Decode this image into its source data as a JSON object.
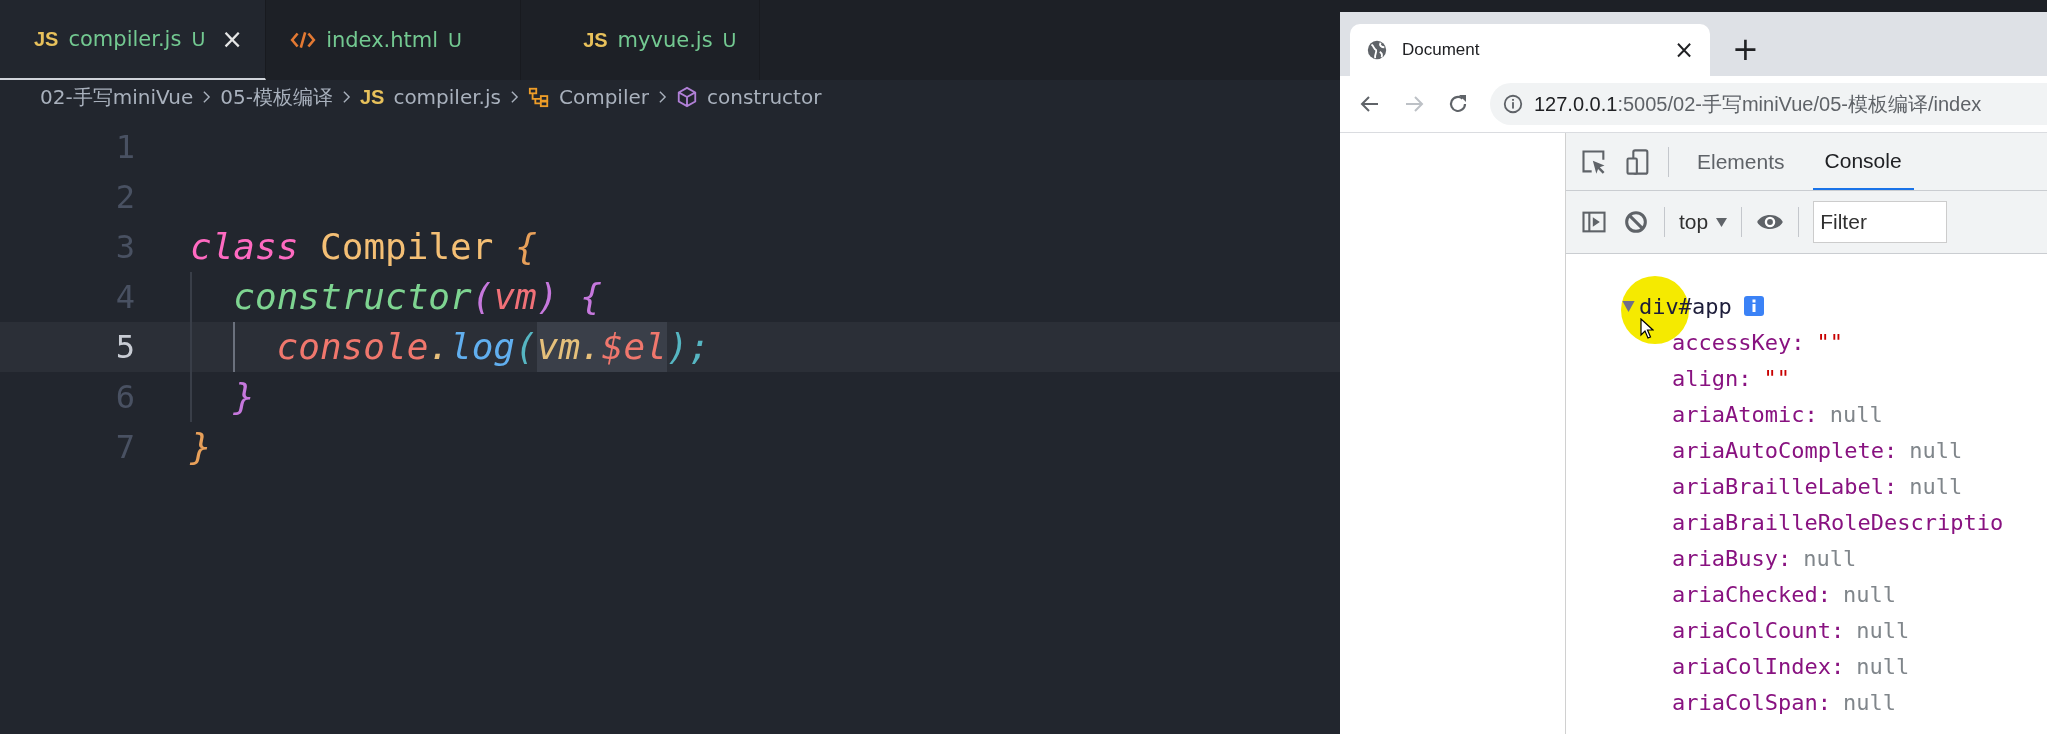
{
  "editor": {
    "tabs": [
      {
        "kind": "js",
        "badge": "JS",
        "label": "compiler.js",
        "status": "U",
        "close": "×",
        "selected": true
      },
      {
        "kind": "html",
        "label": "index.html",
        "status": "U",
        "selected": false
      },
      {
        "kind": "js",
        "badge": "JS",
        "label": "myvue.js",
        "status": "U",
        "selected": false
      }
    ],
    "breadcrumb": [
      {
        "kind": "folder",
        "label": "02-手写miniVue"
      },
      {
        "kind": "folder",
        "label": "05-模板编译"
      },
      {
        "kind": "js",
        "badge": "JS",
        "label": "compiler.js"
      },
      {
        "kind": "class",
        "label": "Compiler"
      },
      {
        "kind": "method",
        "label": "constructor"
      }
    ],
    "lines": [
      {
        "number": "1",
        "current": false
      },
      {
        "number": "2",
        "current": false
      },
      {
        "number": "3",
        "current": false,
        "tokens": [
          {
            "text": "class",
            "kind": "keyword",
            "selected": false
          },
          {
            "text": " Compiler",
            "kind": "class",
            "selected": false
          },
          {
            "text": " {",
            "kind": "brace",
            "selected": false
          }
        ]
      },
      {
        "number": "4",
        "current": false,
        "tokens": [
          {
            "text": "  constructor",
            "kind": "function",
            "selected": false
          },
          {
            "text": "(",
            "kind": "paren",
            "selected": false
          },
          {
            "text": "vm",
            "kind": "param",
            "selected": false
          },
          {
            "text": ")",
            "kind": "paren",
            "selected": false
          },
          {
            "text": " {",
            "kind": "paren",
            "selected": false
          }
        ]
      },
      {
        "number": "5",
        "current": true,
        "tokens": [
          {
            "text": "    console",
            "kind": "variable",
            "selected": false
          },
          {
            "text": ".",
            "kind": "punct",
            "selected": false
          },
          {
            "text": "log",
            "kind": "method",
            "selected": false
          },
          {
            "text": "(",
            "kind": "call",
            "selected": false
          },
          {
            "text": "vm",
            "kind": "object",
            "selected": true
          },
          {
            "text": ".",
            "kind": "punct",
            "selected": true
          },
          {
            "text": "$el",
            "kind": "variable",
            "selected": true
          },
          {
            "text": ");",
            "kind": "call",
            "selected": false
          }
        ]
      },
      {
        "number": "6",
        "current": false,
        "tokens": [
          {
            "text": "  }",
            "kind": "paren",
            "selected": false
          }
        ]
      },
      {
        "number": "7",
        "current": false,
        "tokens": [
          {
            "text": "}",
            "kind": "brace",
            "selected": false
          }
        ]
      }
    ]
  },
  "browser": {
    "tab": {
      "title": "Document",
      "close": "×"
    },
    "new_tab": "+",
    "address": {
      "host": "127.0.0.1",
      "path": ":5005/02-手写miniVue/05-模板编译/index"
    },
    "devtools": {
      "tabs": [
        {
          "label": "Elements",
          "selected": false
        },
        {
          "label": "Console",
          "selected": true
        }
      ],
      "context": "top",
      "filter": {
        "placeholder": "Filter"
      },
      "console": {
        "object": "div#app",
        "expanded": true,
        "properties": [
          {
            "name": "accessKey:",
            "value": "\"\"",
            "kind": "string"
          },
          {
            "name": "align:",
            "value": "\"\"",
            "kind": "string"
          },
          {
            "name": "ariaAtomic:",
            "value": "null",
            "kind": "null"
          },
          {
            "name": "ariaAutoComplete:",
            "value": "null",
            "kind": "null"
          },
          {
            "name": "ariaBrailleLabel:",
            "value": "null",
            "kind": "null"
          },
          {
            "name": "ariaBrailleRoleDescriptio"
          },
          {
            "name": "ariaBusy:",
            "value": "null",
            "kind": "null"
          },
          {
            "name": "ariaChecked:",
            "value": "null",
            "kind": "null"
          },
          {
            "name": "ariaColCount:",
            "value": "null",
            "kind": "null"
          },
          {
            "name": "ariaColIndex:",
            "value": "null",
            "kind": "null"
          },
          {
            "name": "ariaColSpan:",
            "value": "null",
            "kind": "null"
          }
        ]
      }
    }
  }
}
